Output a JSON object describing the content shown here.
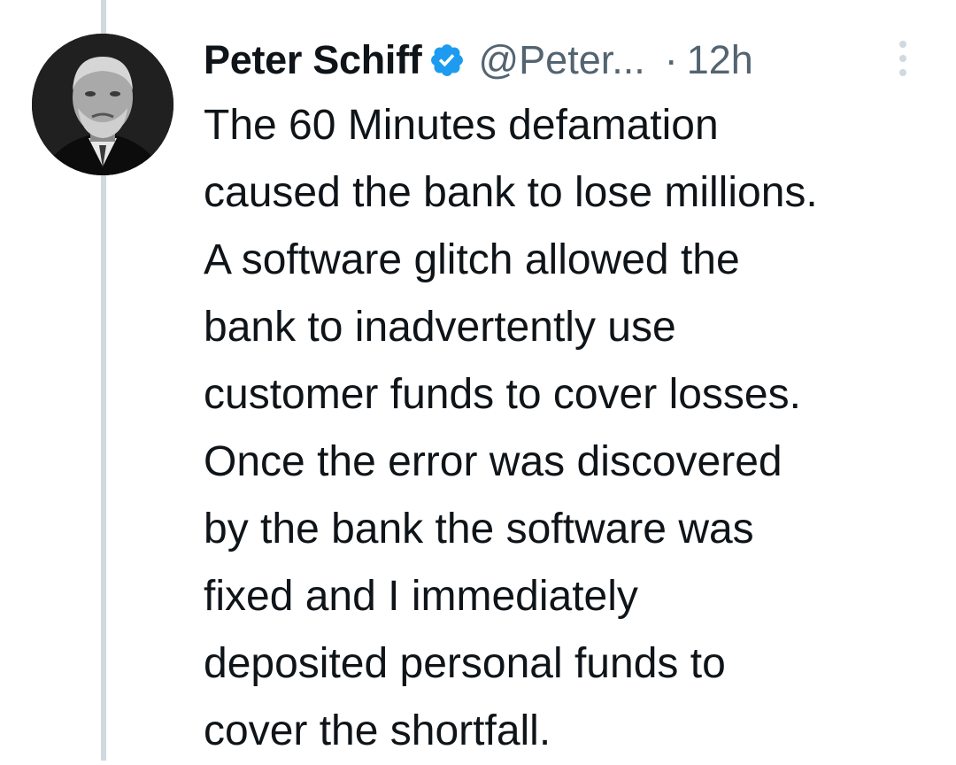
{
  "tweet": {
    "author_name": "Peter Schiff",
    "handle": "@Peter...",
    "separator": "·",
    "time": "12h",
    "lines": [
      "The 60 Minutes defamation",
      "caused the bank to lose millions.",
      "A software glitch allowed the",
      "bank to inadvertently use",
      "customer funds to cover losses.",
      "Once the error was discovered",
      "by the bank the software was",
      "fixed and I immediately",
      "deposited personal funds to",
      "cover the shortfall."
    ]
  },
  "icons": {
    "verified": "verified-badge-icon",
    "more": "more-options-icon"
  },
  "colors": {
    "text": "#0f1419",
    "secondary": "#536471",
    "verified": "#1d9bf0",
    "thread_line": "#cfd9de"
  }
}
